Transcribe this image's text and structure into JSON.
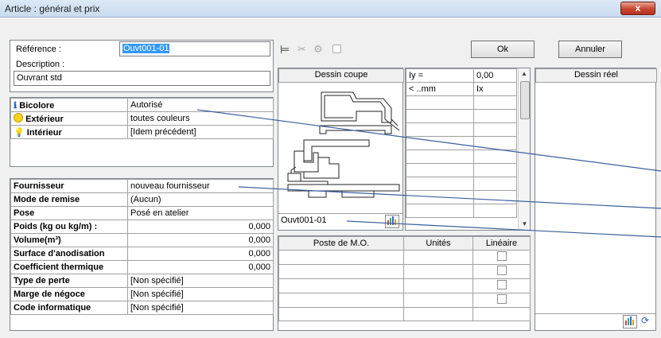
{
  "window": {
    "title": "Article : général et prix",
    "close_glyph": "x"
  },
  "reference": {
    "label": "Référence :",
    "value": "Ouvt001-01"
  },
  "description": {
    "label": "Description :",
    "value": "Ouvrant std"
  },
  "colors": {
    "rows": [
      {
        "label": "Bicolore",
        "value": "Autorisé",
        "icon": "info-icon"
      },
      {
        "label": "Extérieur",
        "value": "toutes couleurs",
        "icon": "bulb-on-icon"
      },
      {
        "label": "Intérieur",
        "value": "[Idem précédent]",
        "icon": "bulb-off-icon"
      }
    ]
  },
  "props": [
    {
      "label": "Fournisseur",
      "value": "nouveau fournisseur"
    },
    {
      "label": "Mode de remise",
      "value": "(Aucun)"
    },
    {
      "label": "Pose",
      "value": "Posé en atelier"
    },
    {
      "label": "Poids (kg ou kg/m) :",
      "value": "0,000"
    },
    {
      "label": "Volume(m³)",
      "value": "0,000"
    },
    {
      "label": "Surface d'anodisation",
      "value": "0,000"
    },
    {
      "label": "Coefficient thermique",
      "value": "0,000"
    },
    {
      "label": "Type de perte",
      "value": "[Non spécifié]"
    },
    {
      "label": "Marge de négoce",
      "value": "[Non spécifié]"
    },
    {
      "label": "Code informatique",
      "value": "[Non spécifié]"
    }
  ],
  "buttons": {
    "ok": "Ok",
    "cancel": "Annuler"
  },
  "drawing": {
    "title": "Dessin coupe",
    "footer": "Ouvt001-01"
  },
  "inertia": {
    "header": [
      "Iy =",
      "0,00"
    ],
    "row": [
      "< ..mm",
      "Ix"
    ]
  },
  "real_drawing": {
    "title": "Dessin réel"
  },
  "mo_table": {
    "headers": [
      "Poste de M.O.",
      "Unités",
      "Linéaire"
    ],
    "row_count": 5
  },
  "accent": {
    "line_color": "#3a5fa0",
    "selection": "#3399ff"
  }
}
